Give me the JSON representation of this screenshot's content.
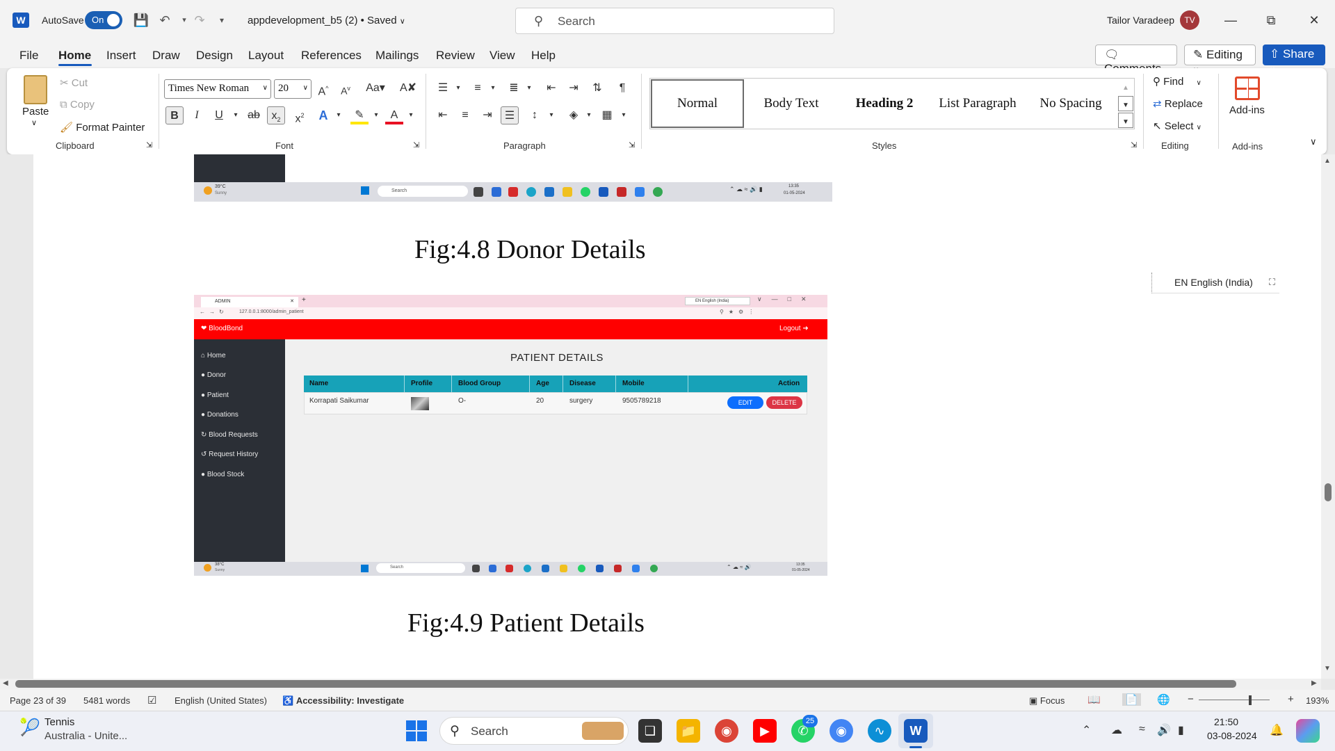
{
  "app": {
    "logo": "W",
    "autosave_label": "AutoSave",
    "autosave_state": "On",
    "doc_title": "appdevelopment_b5 (2) • Saved",
    "search_placeholder": "Search",
    "user_name": "Tailor Varadeep",
    "user_initials": "TV"
  },
  "menu": {
    "items": [
      "File",
      "Home",
      "Insert",
      "Draw",
      "Design",
      "Layout",
      "References",
      "Mailings",
      "Review",
      "View",
      "Help"
    ],
    "comments_label": "Comments",
    "editing_label": "Editing",
    "share_label": "Share"
  },
  "ribbon": {
    "clipboard": {
      "paste": "Paste",
      "cut": "Cut",
      "copy": "Copy",
      "format_painter": "Format Painter",
      "label": "Clipboard"
    },
    "font": {
      "font_name": "Times New Roman",
      "font_size": "20",
      "label": "Font"
    },
    "paragraph": {
      "label": "Paragraph"
    },
    "styles": {
      "items": [
        "Normal",
        "Body Text",
        "Heading 2",
        "List Paragraph",
        "No Spacing"
      ],
      "label": "Styles"
    },
    "editing": {
      "find": "Find",
      "replace": "Replace",
      "select": "Select",
      "label": "Editing"
    },
    "addins": {
      "button": "Add-ins",
      "label": "Add-ins"
    }
  },
  "document": {
    "caption1": "Fig:4.8 Donor Details",
    "caption2": "Fig:4.9 Patient Details",
    "lang_popup": "EN English (India)",
    "screenshot1": {
      "weather_temp": "39°C",
      "weather_cond": "Sunny",
      "search": "Search",
      "time": "13:35",
      "date": "01-05-2024"
    },
    "screenshot2": {
      "tab_title": "ADMIN",
      "url": "127.0.0.1:8000/admin_patient",
      "brand": "BloodBond",
      "logout": "Logout",
      "lang": "EN English (India)",
      "sidebar": [
        "Home",
        "Donor",
        "Patient",
        "Donations",
        "Blood Requests",
        "Request History",
        "Blood Stock"
      ],
      "page_title": "PATIENT DETAILS",
      "columns": [
        "Name",
        "Profile",
        "Blood Group",
        "Age",
        "Disease",
        "Mobile",
        "Action"
      ],
      "row": {
        "name": "Korrapati Saikumar",
        "blood_group": "O-",
        "age": "20",
        "disease": "surgery",
        "mobile": "9505789218"
      },
      "edit_label": "EDIT",
      "delete_label": "DELETE",
      "weather_temp": "38°C",
      "weather_cond": "Sunny",
      "search": "Search",
      "time": "13:35",
      "date": "01-05-2024"
    }
  },
  "status": {
    "page": "Page 23 of 39",
    "words": "5481 words",
    "language": "English (United States)",
    "accessibility": "Accessibility: Investigate",
    "focus": "Focus",
    "zoom": "193%"
  },
  "taskbar": {
    "weather_title": "Tennis",
    "weather_sub": "Australia - Unite...",
    "search": "Search",
    "whatsapp_badge": "25",
    "time": "21:50",
    "date": "03-08-2024"
  },
  "colors": {
    "word_blue": "#185abd",
    "brand_red": "#ff0000",
    "table_header": "#17a2b8",
    "edit_blue": "#0d6efd",
    "delete_red": "#dc3545"
  }
}
